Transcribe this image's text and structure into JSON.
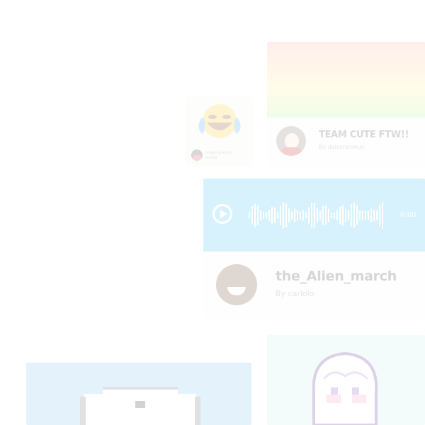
{
  "emoji_card": {
    "icon": "crying-laughing-emoji",
    "author_line": "laughing emoji",
    "author_sub": "Sticker"
  },
  "rainbow_card": {
    "title": "TEAM CUTE FTW!!",
    "byline": "By daisyrenmun"
  },
  "audio_card": {
    "time": "0:00",
    "title": "the_Alien_march",
    "byline": "By carlolo"
  },
  "dog_card": {
    "art": "pixel-dog-art"
  },
  "anime_card": {
    "art": "pixel-anime-character-art"
  },
  "colors": {
    "audio_bg": "#4fc3f7",
    "dog_bg": "#83c6ea",
    "anime_bg": "#c8f1ec"
  }
}
